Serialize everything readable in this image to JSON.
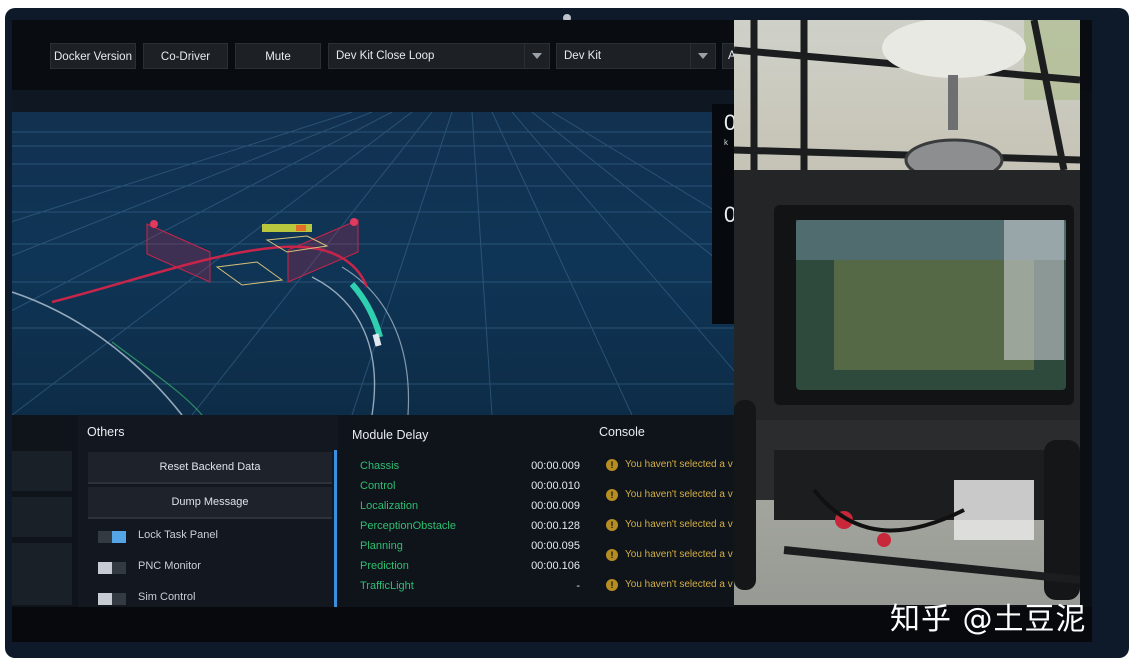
{
  "toolbar": {
    "docker_version": "Docker Version",
    "co_driver": "Co-Driver",
    "mute": "Mute",
    "mode_select": "Dev Kit Close Loop",
    "vehicle_select": "Dev Kit",
    "truncated_select": "A"
  },
  "speed_panel": {
    "speed_digit": "0",
    "speed_unit": "k",
    "second_digit": "0"
  },
  "others": {
    "title": "Others",
    "reset_button": "Reset Backend Data",
    "dump_button": "Dump Message",
    "toggles": [
      {
        "label": "Lock Task Panel",
        "on": true
      },
      {
        "label": "PNC Monitor",
        "on": false
      },
      {
        "label": "Sim Control",
        "on": false
      }
    ]
  },
  "module_delay": {
    "title": "Module Delay",
    "rows": [
      {
        "name": "Chassis",
        "value": "00:00.009"
      },
      {
        "name": "Control",
        "value": "00:00.010"
      },
      {
        "name": "Localization",
        "value": "00:00.009"
      },
      {
        "name": "PerceptionObstacle",
        "value": "00:00.128"
      },
      {
        "name": "Planning",
        "value": "00:00.095"
      },
      {
        "name": "Prediction",
        "value": "00:00.106"
      },
      {
        "name": "TrafficLight",
        "value": "-"
      }
    ]
  },
  "console": {
    "title": "Console",
    "messages": [
      "You haven't selected a v",
      "You haven't selected a v",
      "You haven't selected a v",
      "You haven't selected a v",
      "You haven't selected a v"
    ]
  },
  "watermark": "知乎 @土豆泥",
  "colors": {
    "module_name_green": "#2fbf73",
    "warning_yellow": "#d3b044",
    "toggle_on_blue": "#55a4e6",
    "scene_blue": "#0f3556",
    "obstacle_red": "#c8254a",
    "trajectory_cyan": "#2fd0b0"
  }
}
